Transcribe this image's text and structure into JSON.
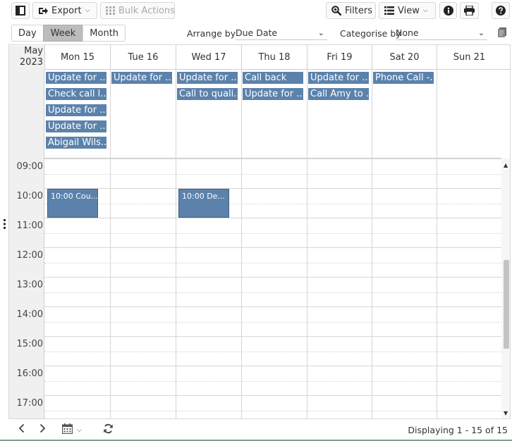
{
  "toolbar": {
    "export_label": "Export",
    "bulk_actions_label": "Bulk Actions",
    "filters_label": "Filters",
    "view_label": "View"
  },
  "view_modes": {
    "day": "Day",
    "week": "Week",
    "month": "Month",
    "active": "Week"
  },
  "arrange": {
    "label": "Arrange by",
    "value": "Due Date"
  },
  "categorise": {
    "label": "Categorise by",
    "value": "None"
  },
  "calendar": {
    "month_label": "May",
    "year_label": "2023",
    "days": [
      "Mon 15",
      "Tue 16",
      "Wed 17",
      "Thu 18",
      "Fri 19",
      "Sat 20",
      "Sun 21"
    ],
    "all_day_events": [
      [
        "Update for ...",
        "Check call l...",
        "Update for ...",
        "Update for ...",
        "Abigail Wils..."
      ],
      [
        "Update for ..."
      ],
      [
        "Update for ...",
        "Call to quali..."
      ],
      [
        "Call back",
        "Update for ..."
      ],
      [
        "Update for ...",
        "Call Amy to ..."
      ],
      [
        "Phone Call -..."
      ],
      []
    ],
    "hours": [
      "09:00",
      "10:00",
      "11:00",
      "12:00",
      "13:00",
      "14:00",
      "15:00",
      "16:00",
      "17:00"
    ],
    "timed_events": [
      {
        "day": 0,
        "label": "10:00 Cou..."
      },
      {
        "day": 2,
        "label": "10:00 De..."
      }
    ]
  },
  "footer": {
    "status": "Displaying 1 - 15 of 15"
  },
  "colors": {
    "event_blue": "#5b82ab",
    "active_tab": "#bcbcbc"
  },
  "icons": [
    "sidebar-toggle-icon",
    "export-icon",
    "grid-icon",
    "search-plus-icon",
    "list-icon",
    "info-icon",
    "print-icon",
    "help-icon",
    "notes-icon",
    "chevron-left-icon",
    "chevron-right-icon",
    "calendar-icon",
    "refresh-icon",
    "drag-handle-icon"
  ]
}
